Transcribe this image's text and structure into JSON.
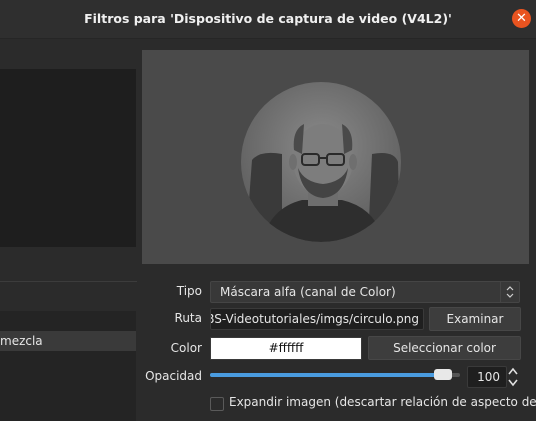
{
  "window": {
    "title": "Filtros para 'Dispositivo de captura de video (V4L2)'",
    "close_icon": "close-icon"
  },
  "left_panel": {
    "selected_item": "mezcla"
  },
  "form": {
    "tipo_label": "Tipo",
    "tipo_value": "Máscara alfa (canal de Color)",
    "ruta_label": "Ruta",
    "ruta_value": "ABS-Videotutoriales/imgs/circulo.png",
    "examinar_label": "Examinar",
    "color_label": "Color",
    "color_value": "#ffffff",
    "select_color_label": "Seleccionar color",
    "opacity_label": "Opacidad",
    "opacity_value": "100",
    "opacity_fraction": 0.93,
    "expand_label": "Expandir imagen (descartar relación de aspecto de ima",
    "expand_checked": false
  },
  "colors": {
    "accent": "#4a9ce0",
    "close": "#e95420"
  }
}
